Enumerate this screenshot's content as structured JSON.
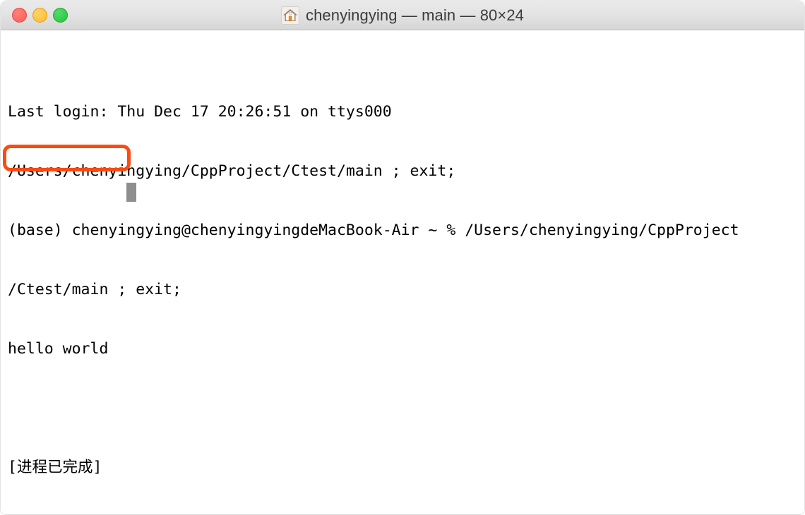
{
  "window": {
    "titlebar": {
      "title": "chenyingying — main — 80×24",
      "home_icon": "home-icon",
      "buttons": [
        {
          "name": "close",
          "label": "Close",
          "color": "#fa5e55"
        },
        {
          "name": "minimize",
          "label": "Minimize",
          "color": "#fcbb2c"
        },
        {
          "name": "zoom",
          "label": "Zoom",
          "color": "#22c63c"
        }
      ]
    },
    "terminal": {
      "lines": [
        "Last login: Thu Dec 17 20:26:51 on ttys000",
        "/Users/chenyingying/CppProject/Ctest/main ; exit;",
        "(base) chenyingying@chenyingyingdeMacBook-Air ~ % /Users/chenyingying/CppProject",
        "/Ctest/main ; exit;",
        "hello world",
        "",
        "[进程已完成]"
      ],
      "cursor": "block-cursor",
      "cursor_color": "#8e8e8e",
      "foreground": "#000000",
      "background": "#ffffff"
    },
    "annotation": {
      "name": "hello-world-highlight",
      "target_text": "hello world",
      "color": "#fc4a11"
    }
  }
}
